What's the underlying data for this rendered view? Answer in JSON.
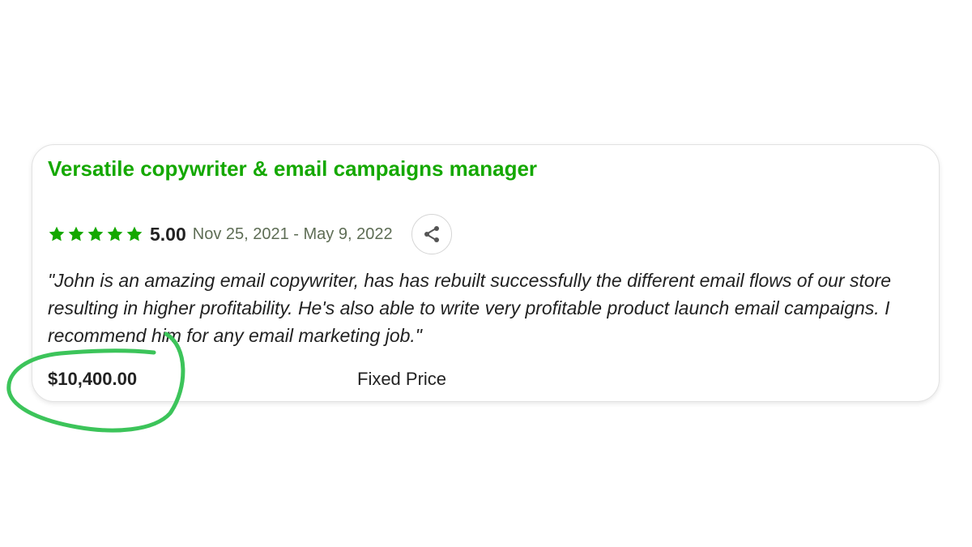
{
  "card": {
    "title": "Versatile copywriter & email campaigns manager",
    "rating": {
      "stars": 5,
      "score": "5.00",
      "dates": "Nov 25, 2021 - May 9, 2022"
    },
    "share_icon": "share-icon",
    "review": "\"John is an amazing email copywriter, has has rebuilt successfully the different email flows of our store resulting in higher profitability. He's also able to write very profitable product launch email campaigns. I recommend him for any email marketing job.\"",
    "price": "$10,400.00",
    "price_type": "Fixed Price"
  },
  "colors": {
    "brand_green": "#14a800",
    "annotation_green": "#3cc45a",
    "text": "#222222"
  }
}
